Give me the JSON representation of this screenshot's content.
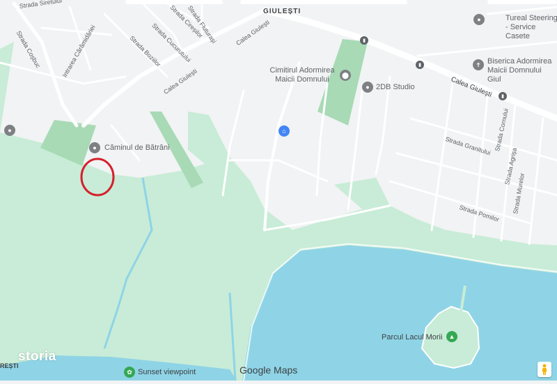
{
  "map": {
    "district": "GIULEȘTI",
    "watermark": "storia",
    "provider": "Google Maps",
    "colors": {
      "land": "#f1f3f4",
      "park": "#c8ecd7",
      "green": "#a8dab5",
      "water": "#8fd4e6",
      "road": "#ffffff",
      "marker_circle": "#d6202c"
    },
    "streets": {
      "siretului": "Strada Siretului",
      "cosbuc": "Strada Coșbuc",
      "fluturasi": "Strada Fluturași",
      "ciresilor": "Strada Cireșilor",
      "cucurutului": "Strada Cucurutului",
      "bostan": "Strada Boziilor",
      "caramidariei": "Intrarea Cărămidăriei",
      "calea_giulesti_1": "Calea Giulești",
      "calea_giulesti_2": "Calea Giulești",
      "calea_giulesti_3": "Calea Giulești",
      "granitului": "Strada Granitului",
      "cornului": "Strada Cornului",
      "agrisa": "Strada Agrișa",
      "murelor": "Strada Murelor",
      "pomilor": "Strada Pomilor",
      "bucuresti_edge": "REȘTI"
    },
    "pois": {
      "cimitir": "Cimitirul Adormirea Maicii Domnului",
      "studio": "2DB Studio",
      "biserica": "Biserica Adormirea Maicii Domnului Giul",
      "tureal": "Tureal Steering - Service Casete",
      "camin": "Căminul de Bătrâni",
      "parc": "Parcul Lacul Morii",
      "sunset": "Sunset viewpoint"
    },
    "icons": [
      "pin-icon",
      "home-icon",
      "transit-icon",
      "tree-icon",
      "pegman-icon",
      "photo-icon"
    ]
  }
}
